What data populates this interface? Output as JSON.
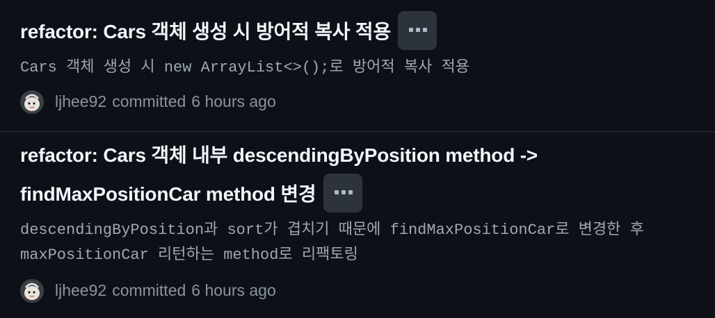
{
  "commits": [
    {
      "title": "refactor: Cars 객체 생성 시 방어적 복사 적용",
      "title_lines": [
        "refactor: Cars 객체 생성 시 방어적 복사 적용"
      ],
      "description_lines": [
        "Cars 객체 생성 시 new ArrayList<>();로 방어적 복사 적용"
      ],
      "author": "ljhee92",
      "verb": "committed",
      "when": "6 hours ago",
      "avatar_icon": "avatar-icon",
      "ellipsis_icon": "kebab-horizontal-icon"
    },
    {
      "title_lines": [
        "refactor: Cars 객체 내부 descendingByPosition method ->",
        "findMaxPositionCar method 변경"
      ],
      "description_lines": [
        "descendingByPosition과 sort가 겹치기 때문에 findMaxPositionCar로 변경한 후",
        "maxPositionCar 리턴하는 method로 리팩토링"
      ],
      "author": "ljhee92",
      "verb": "committed",
      "when": "6 hours ago",
      "avatar_icon": "avatar-icon",
      "ellipsis_icon": "kebab-horizontal-icon"
    }
  ],
  "colors": {
    "background": "#0d1117",
    "title": "#f0f6fc",
    "muted": "#8b949e",
    "description": "#9ea7b3",
    "button_bg": "#2d333b",
    "divider": "#30363d"
  }
}
